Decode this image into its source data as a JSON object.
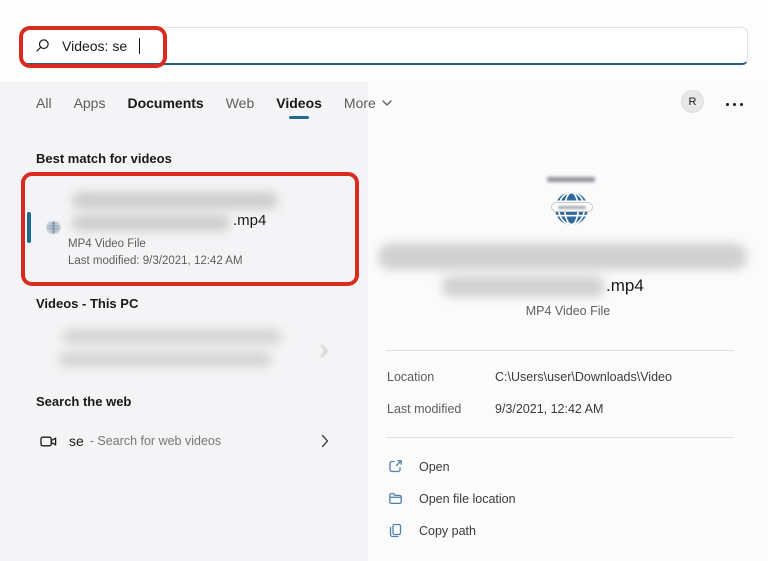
{
  "search": {
    "query": "Videos: se"
  },
  "tabs": {
    "items": [
      {
        "label": "All"
      },
      {
        "label": "Apps"
      },
      {
        "label": "Documents"
      },
      {
        "label": "Web"
      },
      {
        "label": "Videos"
      }
    ],
    "more_label": "More"
  },
  "header": {
    "avatar_initial": "R"
  },
  "left_panel": {
    "best_match_header": "Best match for videos",
    "best_match": {
      "extension": ".mp4",
      "subtitle": "MP4 Video File",
      "last_modified": "Last modified: 9/3/2021, 12:42 AM"
    },
    "this_pc_header": "Videos - This PC",
    "web_header": "Search the web",
    "web_item": {
      "query": "se",
      "description": "- Search for web videos"
    }
  },
  "preview_panel": {
    "extension": ".mp4",
    "file_type": "MP4 Video File",
    "details": [
      {
        "label": "Location",
        "value": "C:\\Users\\user\\Downloads\\Video"
      },
      {
        "label": "Last modified",
        "value": "9/3/2021, 12:42 AM"
      }
    ],
    "actions": [
      {
        "icon": "open-icon",
        "label": "Open"
      },
      {
        "icon": "folder-icon",
        "label": "Open file location"
      },
      {
        "icon": "copy-icon",
        "label": "Copy path"
      }
    ]
  },
  "colors": {
    "accent": "#1f6b8f",
    "annotation_red": "#d92b1f",
    "action_icon_blue": "#4f81ab"
  }
}
